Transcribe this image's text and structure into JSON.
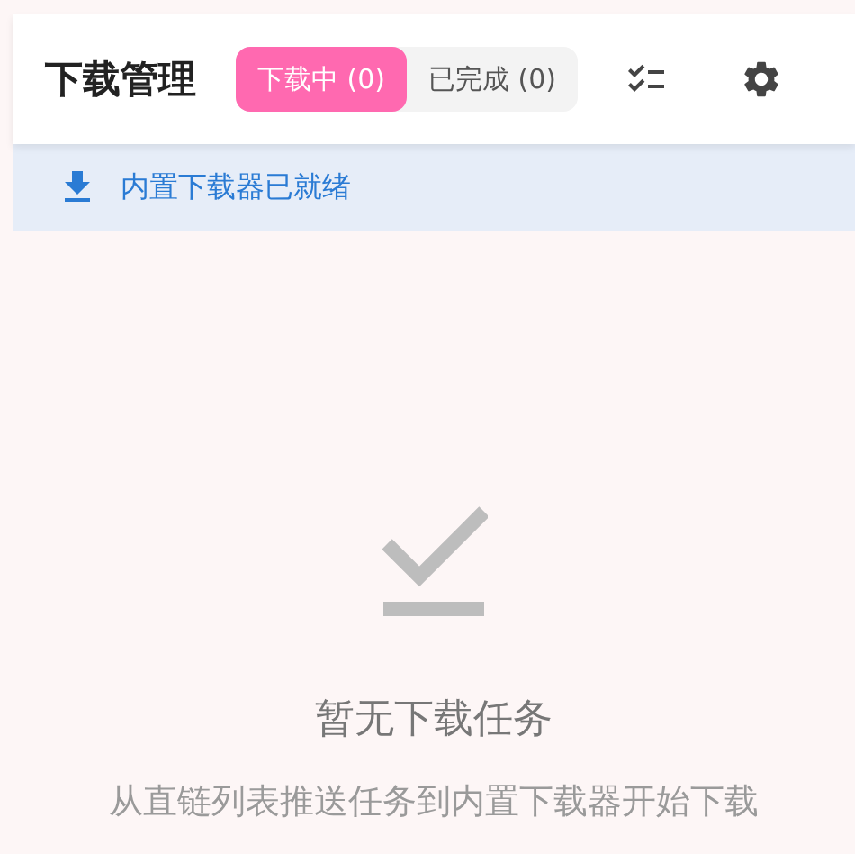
{
  "header": {
    "title": "下载管理",
    "tabs": [
      {
        "label": "下载中 (0)",
        "selected": true
      },
      {
        "label": "已完成 (0)",
        "selected": false
      }
    ]
  },
  "status_banner": {
    "text": "内置下载器已就绪"
  },
  "empty_state": {
    "title": "暂无下载任务",
    "subtitle": "从直链列表推送任务到内置下载器开始下载"
  }
}
